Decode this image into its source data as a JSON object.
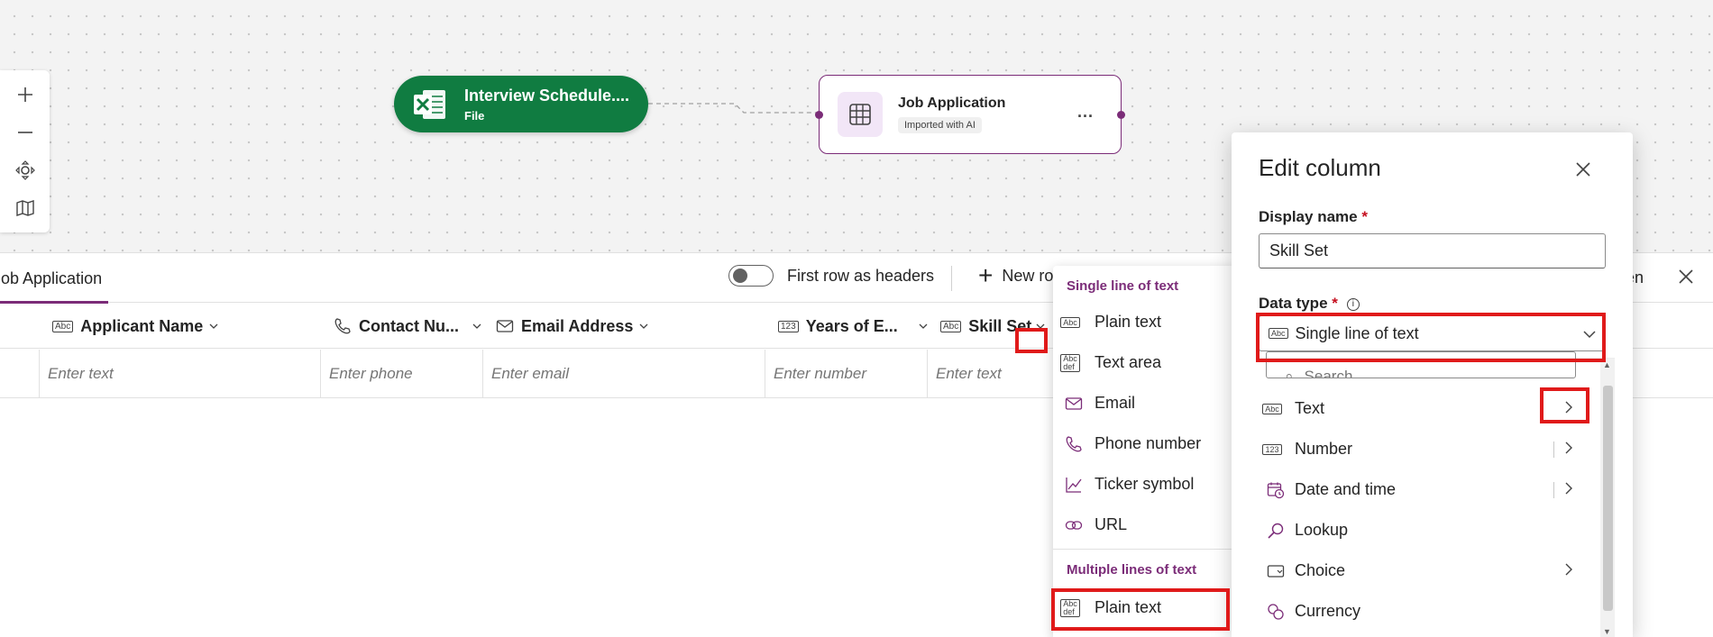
{
  "canvas": {
    "toolbar": {
      "zoom_in": "+",
      "zoom_out": "—"
    },
    "nodes": {
      "excel": {
        "title": "Interview Schedule....",
        "subtitle": "File"
      },
      "table": {
        "title": "Job Application",
        "badge": "Imported with AI",
        "more": "..."
      }
    }
  },
  "grid": {
    "tab_label": "Job Application",
    "toggle_label": "First row as headers",
    "new_row_label": "New ro",
    "screen_label": "een",
    "columns": [
      {
        "label": "Applicant Name",
        "icon": "abc-icon",
        "placeholder": "Enter text"
      },
      {
        "label": "Contact Nu...",
        "icon": "phone-icon",
        "placeholder": "Enter phone"
      },
      {
        "label": "Email Address",
        "icon": "mail-icon",
        "placeholder": "Enter email"
      },
      {
        "label": "Years of E...",
        "icon": "number-icon",
        "placeholder": "Enter number"
      },
      {
        "label": "Skill Set",
        "icon": "abc-icon",
        "placeholder": "Enter text"
      }
    ]
  },
  "type_menu": {
    "group1": "Single line of text",
    "single_items": [
      {
        "label": "Plain text",
        "icon": "abc-icon"
      },
      {
        "label": "Text area",
        "icon": "abc-def-icon"
      },
      {
        "label": "Email",
        "icon": "mail-icon"
      },
      {
        "label": "Phone number",
        "icon": "phone-icon"
      },
      {
        "label": "Ticker symbol",
        "icon": "chart-line-icon"
      },
      {
        "label": "URL",
        "icon": "link-icon"
      }
    ],
    "group2": "Multiple lines of text",
    "multi_items": [
      {
        "label": "Plain text",
        "icon": "abc-def-icon"
      }
    ]
  },
  "edit_panel": {
    "title": "Edit column",
    "display_name_label": "Display name",
    "required_mark": "*",
    "display_name_value": "Skill Set",
    "data_type_label": "Data type",
    "info_glyph": "i",
    "data_type_value": "Single line of text",
    "search_placeholder": "Search",
    "options": [
      {
        "label": "Text",
        "icon": "abc-icon",
        "submenu": true
      },
      {
        "label": "Number",
        "icon": "number-icon",
        "submenu": true
      },
      {
        "label": "Date and time",
        "icon": "calendar-clock-icon",
        "submenu": true
      },
      {
        "label": "Lookup",
        "icon": "search-icon",
        "submenu": false
      },
      {
        "label": "Choice",
        "icon": "choice-icon",
        "submenu": true
      },
      {
        "label": "Currency",
        "icon": "currency-icon",
        "submenu": false
      }
    ]
  },
  "colors": {
    "accent": "#7b2c78",
    "excel_green": "#107c41",
    "highlight": "#e01a1a"
  }
}
